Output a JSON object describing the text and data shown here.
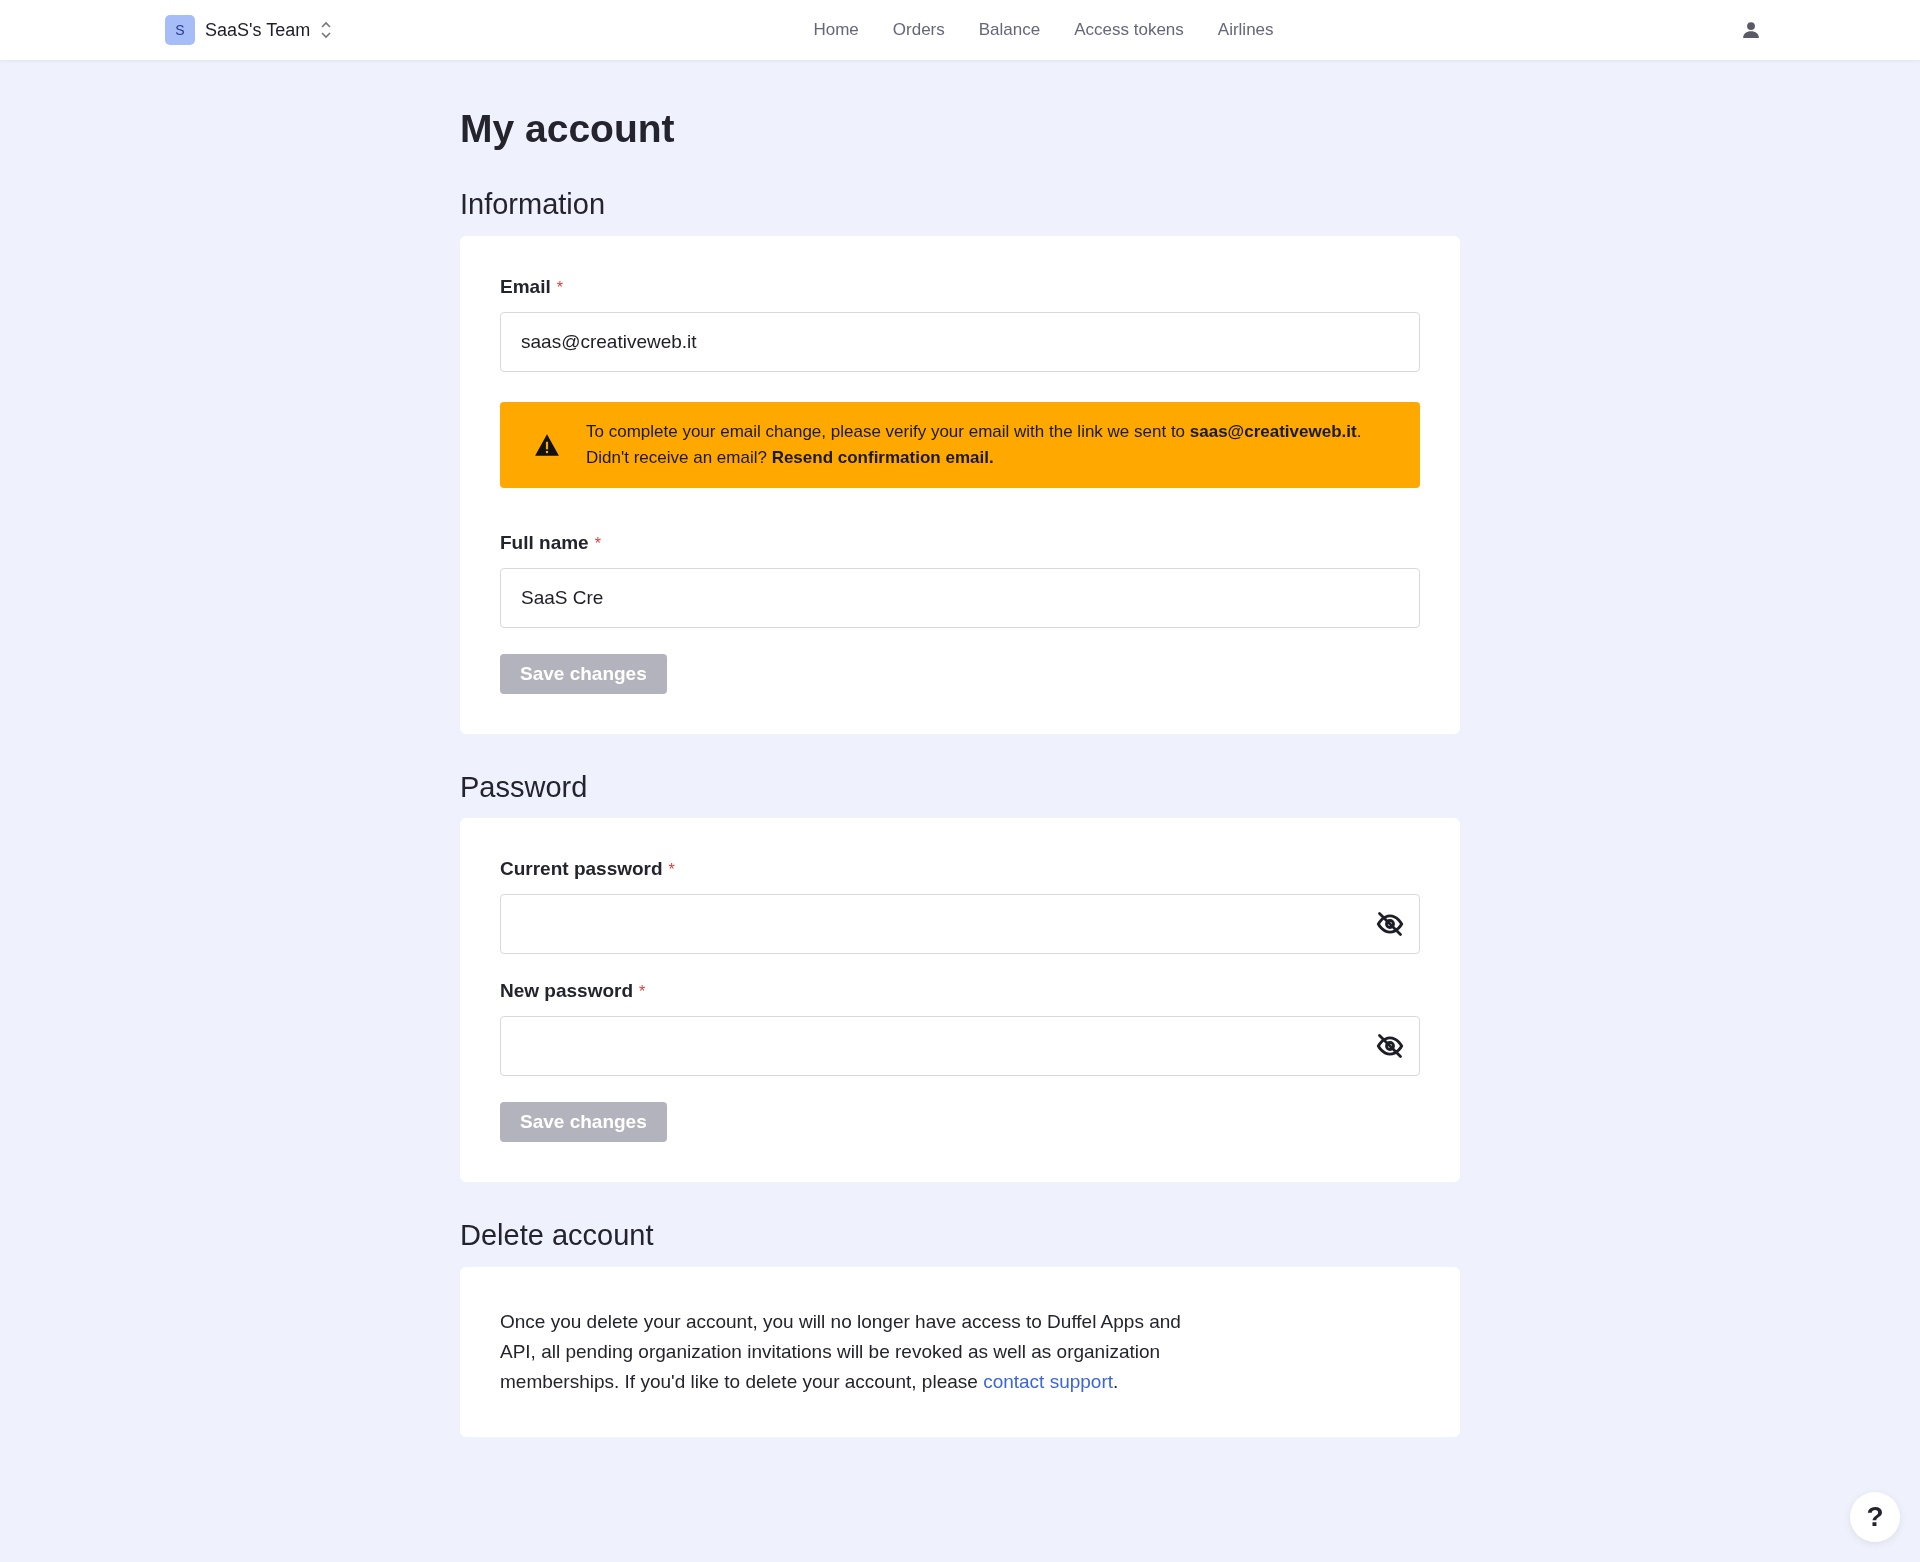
{
  "nav": {
    "team_initial": "S",
    "team_name": "SaaS's Team",
    "links": [
      {
        "label": "Home"
      },
      {
        "label": "Orders"
      },
      {
        "label": "Balance"
      },
      {
        "label": "Access tokens"
      },
      {
        "label": "Airlines"
      }
    ]
  },
  "page_title": "My account",
  "sections": [
    {
      "title": "Information",
      "fields": [
        {
          "label": "Email",
          "required_mark": "*",
          "value": "saas@creativeweb.it",
          "password": false
        },
        {
          "kind": "warning",
          "text": "To complete your email change, please verify your email with the link we sent to **saas@creativeweb.it**.",
          "text_2": "Didn't receive an email?",
          "link": "Resend confirmation email."
        },
        {
          "label": "Full name",
          "required_mark": "*",
          "value": "SaaS Cre",
          "password": false
        }
      ],
      "button": {
        "label": "Save changes",
        "disabled": true
      }
    },
    {
      "title": "Password",
      "fields": [
        {
          "label": "Current password",
          "required_mark": "*",
          "password": true
        },
        {
          "label": "New password",
          "required_mark": "*",
          "password": true
        }
      ],
      "button": {
        "label": "Save changes",
        "disabled": true
      }
    },
    {
      "title": "Delete account",
      "paragraph": "Once you delete your account, you will no longer have access to Duffel Apps and API, all pending organization invitations will be revoked as well as organization memberships. If you'd like to delete your account, please",
      "link": "contact support",
      "after_link": "."
    }
  ],
  "help": "?"
}
